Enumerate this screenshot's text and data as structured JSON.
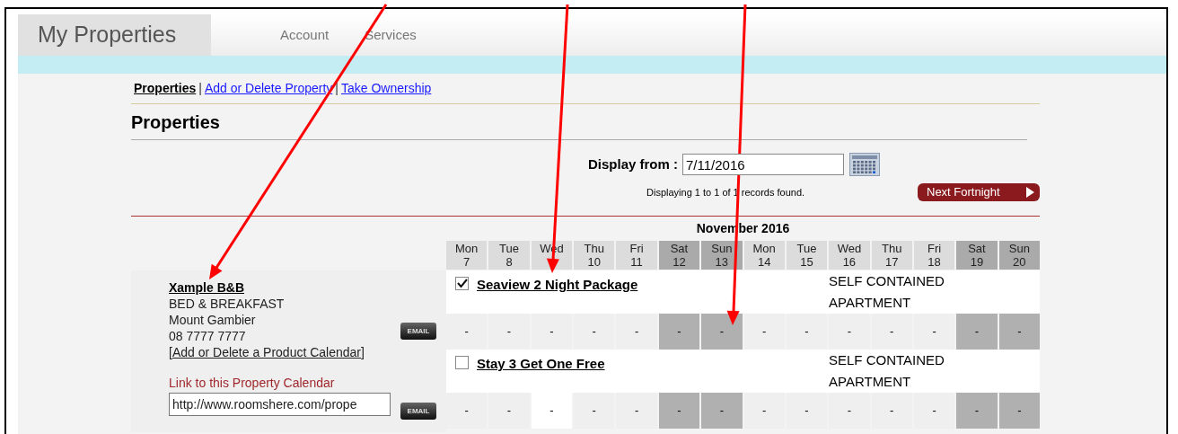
{
  "top_tabs": [
    {
      "label": "My Properties",
      "selected": true
    },
    {
      "label": "Account",
      "selected": false
    },
    {
      "label": "Services",
      "selected": false
    }
  ],
  "subnav": [
    {
      "label": "Properties",
      "selected": true,
      "separator": "|"
    },
    {
      "label": "Add or Delete Property",
      "selected": false,
      "separator": "|"
    },
    {
      "label": "Take Ownership",
      "selected": false
    }
  ],
  "heading": "Properties",
  "display_from": {
    "label": "Display from :",
    "value": "7/11/2016"
  },
  "records_text": "Displaying 1 to 1 of 1 records found.",
  "next_button": "Next Fortnight",
  "month": "November 2016",
  "days": [
    {
      "day": "Mon",
      "date": "7",
      "weekend": false
    },
    {
      "day": "Tue",
      "date": "8",
      "weekend": false
    },
    {
      "day": "Wed",
      "weekend": false
    },
    {
      "day": "Thu",
      "date": "10",
      "weekend": false
    },
    {
      "day": "Fri",
      "date": "11",
      "weekend": false
    },
    {
      "day": "Sat",
      "date": "12",
      "weekend": true
    },
    {
      "day": "Sun",
      "date": "13",
      "weekend": true
    },
    {
      "day": "Mon",
      "date": "14",
      "weekend": false
    },
    {
      "day": "Tue",
      "date": "15",
      "weekend": false
    },
    {
      "day": "Wed",
      "date": "16",
      "weekend": false
    },
    {
      "day": "Thu",
      "date": "17",
      "weekend": false
    },
    {
      "day": "Fri",
      "date": "18",
      "weekend": false
    },
    {
      "day": "Sat",
      "date": "19",
      "weekend": true
    },
    {
      "day": "Sun",
      "date": "20",
      "weekend": true
    }
  ],
  "property": {
    "name": "Xample B&B",
    "type": "BED & BREAKFAST",
    "location": "Mount Gambier",
    "phone": "08 7777 7777",
    "calendar_link": "[Add or Delete a Product Calendar]",
    "link_label": "Link to this Property Calendar",
    "link_value": "http://www.roomshere.com/prope",
    "email_buttons": [
      "EMAIL",
      "EMAIL"
    ]
  },
  "products": [
    {
      "name": "Seaview 2 Night Package",
      "checked": true,
      "category": "SELF CONTAINED APARTMENT",
      "cells": [
        {
          "text": "-",
          "kind": "weekday"
        },
        {
          "text": "-",
          "kind": "weekday"
        },
        {
          "text": "-",
          "kind": "weekday"
        },
        {
          "text": "-",
          "kind": "weekday"
        },
        {
          "text": "-",
          "kind": "weekday"
        },
        {
          "text": "-",
          "kind": "weekend"
        },
        {
          "text": "-",
          "kind": "weekend"
        },
        {
          "text": "-",
          "kind": "weekday"
        },
        {
          "text": "-",
          "kind": "weekday"
        },
        {
          "text": "-",
          "kind": "weekday"
        },
        {
          "text": "-",
          "kind": "weekday"
        },
        {
          "text": "-",
          "kind": "weekday"
        },
        {
          "text": "-",
          "kind": "weekend"
        },
        {
          "text": "-",
          "kind": "weekend"
        }
      ]
    },
    {
      "name": "Stay 3 Get One Free",
      "checked": false,
      "category": "SELF CONTAINED APARTMENT",
      "cells": [
        {
          "text": "-",
          "kind": "weekday"
        },
        {
          "text": "-",
          "kind": "weekday"
        },
        {
          "text": "-",
          "kind": "blank"
        },
        {
          "text": "-",
          "kind": "weekday"
        },
        {
          "text": "-",
          "kind": "weekday"
        },
        {
          "text": "-",
          "kind": "weekend"
        },
        {
          "text": "-",
          "kind": "weekend"
        },
        {
          "text": "-",
          "kind": "weekday"
        },
        {
          "text": "-",
          "kind": "weekday"
        },
        {
          "text": "-",
          "kind": "weekday"
        },
        {
          "text": "-",
          "kind": "weekday"
        },
        {
          "text": "-",
          "kind": "weekday"
        },
        {
          "text": "-",
          "kind": "weekend"
        },
        {
          "text": "-",
          "kind": "weekend"
        }
      ]
    }
  ]
}
